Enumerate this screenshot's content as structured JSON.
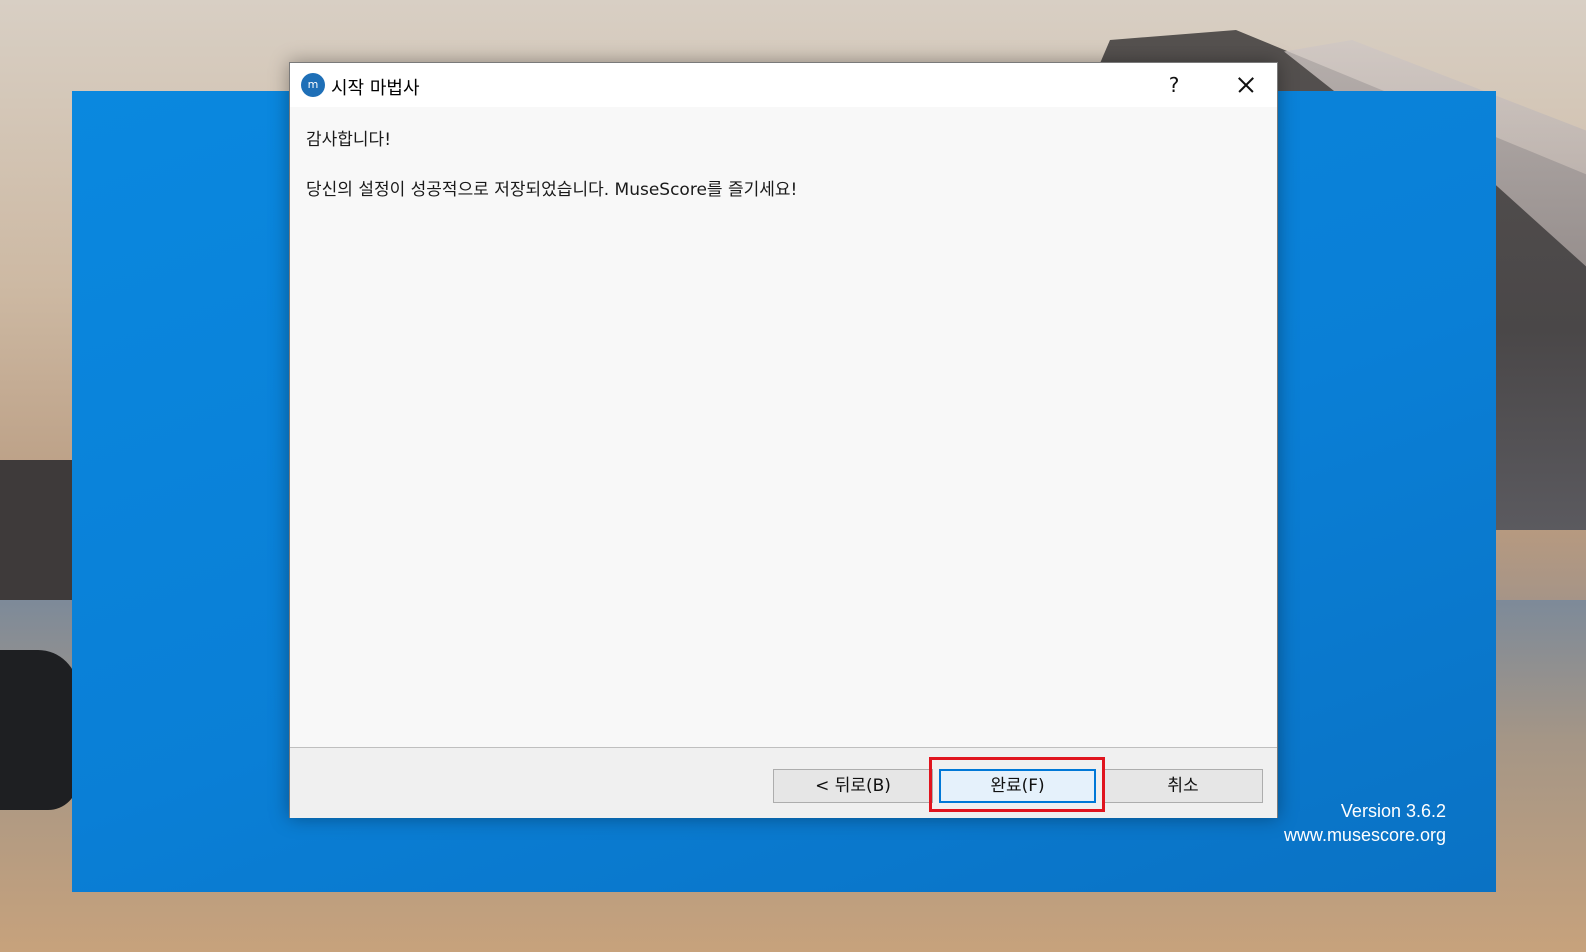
{
  "splash": {
    "version": "Version 3.6.2",
    "website": "www.musescore.org",
    "background_color": "#0a88df"
  },
  "dialog": {
    "title": "시작 마법사",
    "app_icon_glyph": "m",
    "help_label": "?",
    "content": {
      "heading": "감사합니다!",
      "message": "당신의 설정이 성공적으로 저장되었습니다. MuseScore를 즐기세요!"
    },
    "buttons": {
      "back": "< 뒤로(B)",
      "finish": "완료(F)",
      "cancel": "취소"
    },
    "highlight_color": "#e0141e"
  }
}
